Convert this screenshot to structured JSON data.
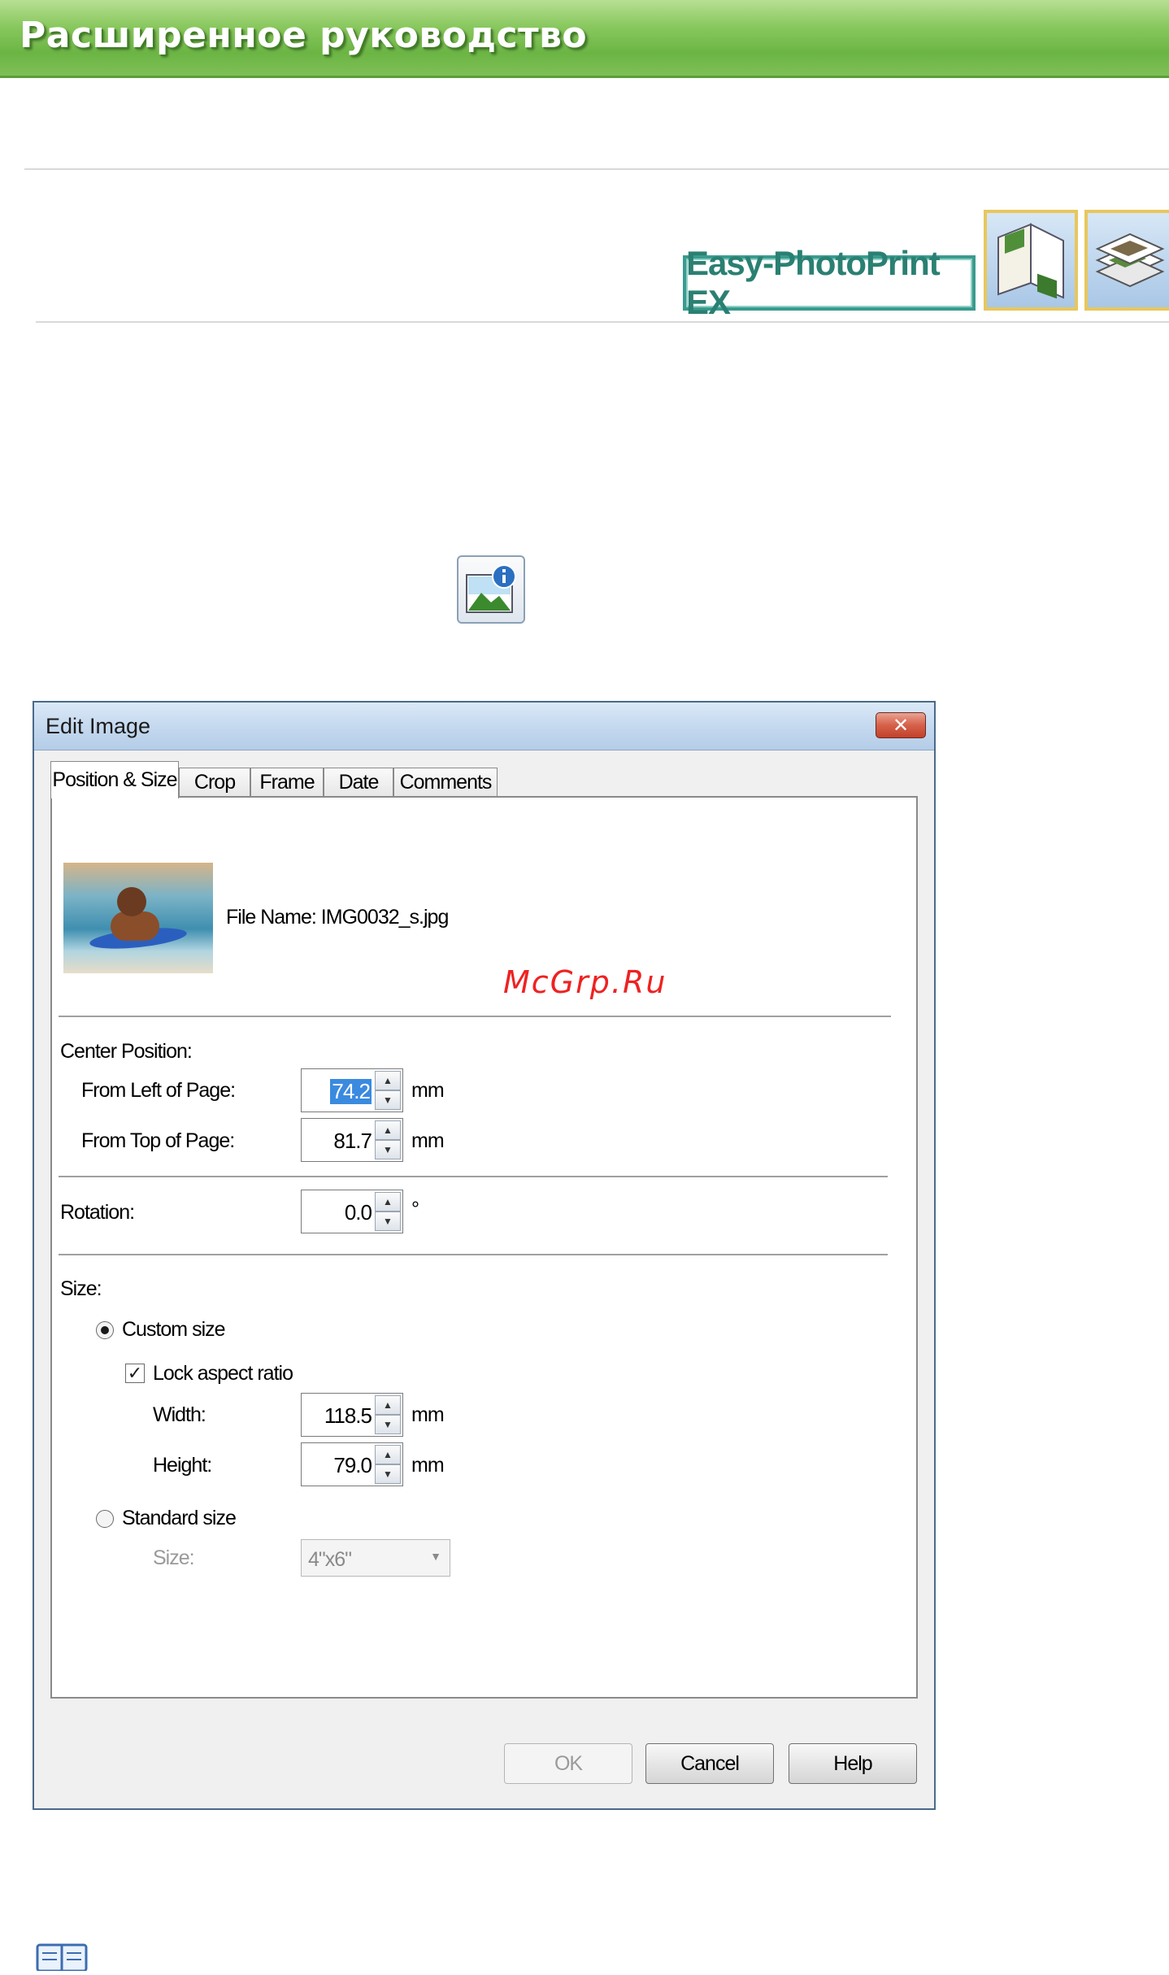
{
  "banner": {
    "title": "Расширенное руководство"
  },
  "product": {
    "label": "Easy-PhotoPrint EX"
  },
  "mode_icons": [
    "album-mode-icon",
    "layout-mode-icon"
  ],
  "dialog": {
    "title": "Edit Image",
    "close_label": "✕",
    "tabs": [
      {
        "label": "Position & Size",
        "active": true
      },
      {
        "label": "Crop"
      },
      {
        "label": "Frame"
      },
      {
        "label": "Date"
      },
      {
        "label": "Comments"
      }
    ],
    "file_name": "File Name: IMG0032_s.jpg",
    "watermark": "McGrp.Ru",
    "center_position": {
      "label": "Center Position:",
      "from_left_label": "From Left of Page:",
      "from_left_value": "74.2",
      "from_top_label": "From Top of Page:",
      "from_top_value": "81.7",
      "unit": "mm"
    },
    "rotation": {
      "label": "Rotation:",
      "value": "0.0",
      "unit": "°"
    },
    "size": {
      "label": "Size:",
      "custom_size_label": "Custom size",
      "custom_size_selected": true,
      "lock_aspect_label": "Lock aspect ratio",
      "lock_aspect_checked": true,
      "width_label": "Width:",
      "width_value": "118.5",
      "height_label": "Height:",
      "height_value": "79.0",
      "unit": "mm",
      "standard_size_label": "Standard size",
      "standard_size_selected": false,
      "standard_size_field_label": "Size:",
      "standard_size_value": "4\"x6\""
    },
    "buttons": {
      "ok": "OK",
      "cancel": "Cancel",
      "help": "Help"
    }
  },
  "spinner_arrows": {
    "up": "▲",
    "down": "▼"
  },
  "checkmark": "✓",
  "dropdown_arrow": "▼"
}
